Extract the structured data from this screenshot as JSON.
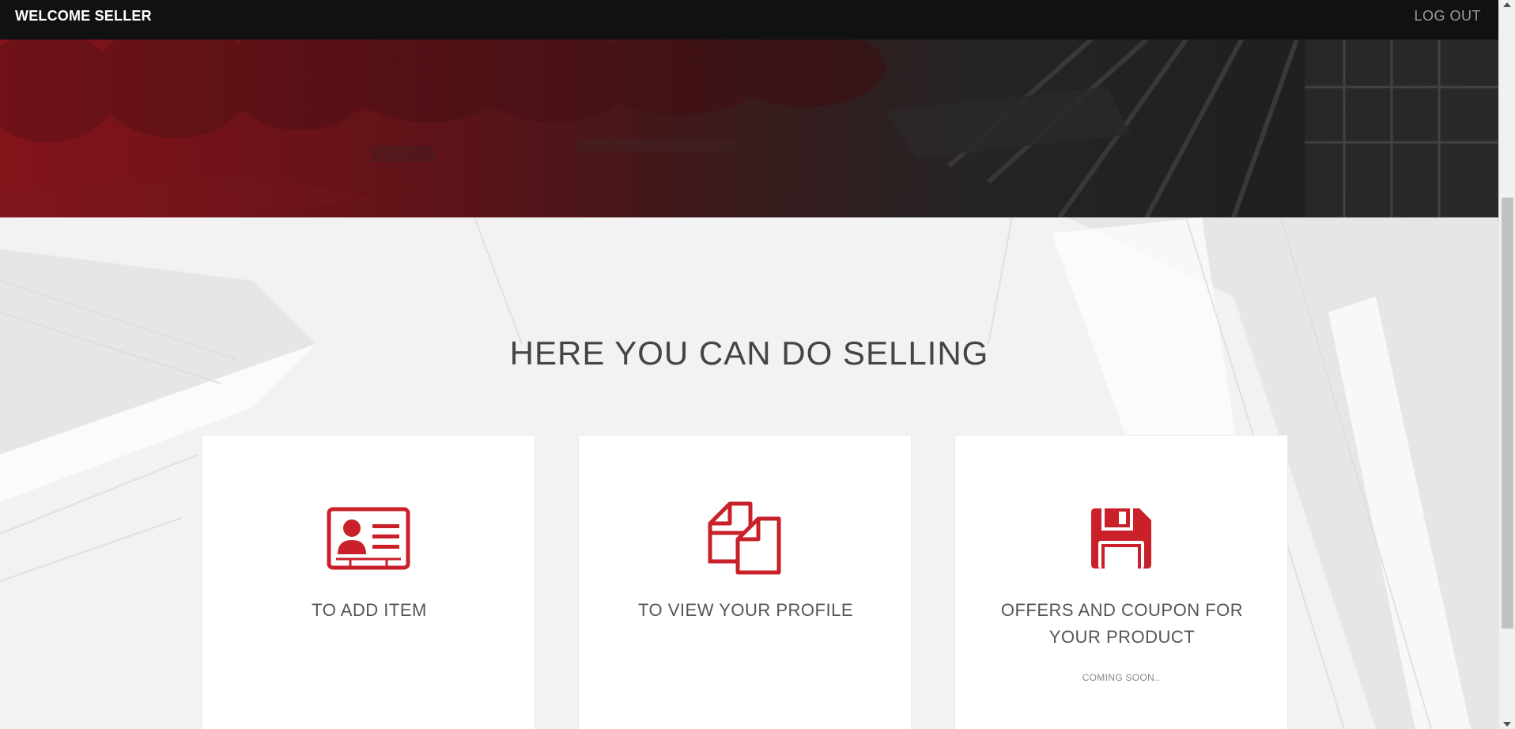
{
  "navbar": {
    "brand": "WELCOME SELLER",
    "logout_label": "LOG OUT"
  },
  "main": {
    "title": "HERE YOU CAN DO SELLING",
    "accent_color": "#c9202a",
    "cards": [
      {
        "icon": "id-card-icon",
        "label": "TO ADD ITEM",
        "note": ""
      },
      {
        "icon": "copy-files-icon",
        "label": "TO VIEW YOUR PROFILE",
        "note": ""
      },
      {
        "icon": "floppy-disk-icon",
        "label": "OFFERS AND COUPON FOR YOUR PRODUCT",
        "note": "COMING SOON.."
      }
    ]
  }
}
